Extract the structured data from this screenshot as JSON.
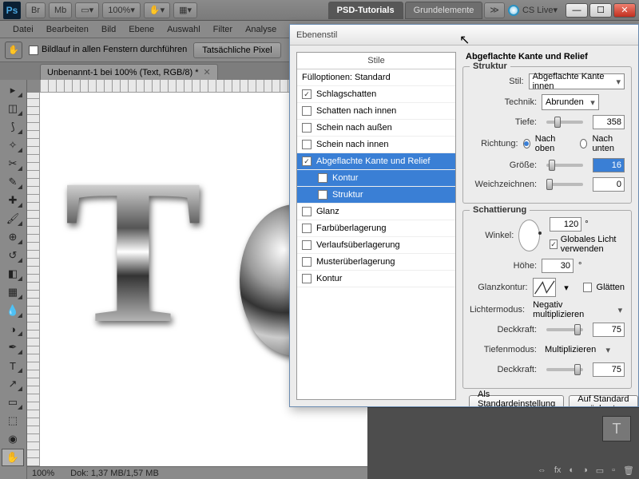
{
  "titlebar": {
    "zoom": "100%",
    "tabs": [
      "PSD-Tutorials",
      "Grundelemente"
    ],
    "cslive": "CS Live"
  },
  "menu": [
    "Datei",
    "Bearbeiten",
    "Bild",
    "Ebene",
    "Auswahl",
    "Filter",
    "Analyse"
  ],
  "optbar": {
    "scroll_all": "Bildlauf in allen Fenstern durchführen",
    "actual_px": "Tatsächliche Pixel"
  },
  "doc": {
    "tab": "Unbenannt-1 bei 100% (Text, RGB/8) *"
  },
  "status": {
    "zoom": "100%",
    "doc": "Dok: 1,37 MB/1,57 MB"
  },
  "dialog": {
    "title": "Ebenenstil",
    "list_head": "Stile",
    "items": [
      {
        "label": "Fülloptionen: Standard",
        "chk": null
      },
      {
        "label": "Schlagschatten",
        "chk": true
      },
      {
        "label": "Schatten nach innen",
        "chk": false
      },
      {
        "label": "Schein nach außen",
        "chk": false
      },
      {
        "label": "Schein nach innen",
        "chk": false
      },
      {
        "label": "Abgeflachte Kante und Relief",
        "chk": true,
        "sel": true
      },
      {
        "label": "Kontur",
        "chk": false,
        "sub": true,
        "sel": true
      },
      {
        "label": "Struktur",
        "chk": false,
        "sub": true,
        "sel": true
      },
      {
        "label": "Glanz",
        "chk": false
      },
      {
        "label": "Farbüberlagerung",
        "chk": false
      },
      {
        "label": "Verlaufsüberlagerung",
        "chk": false
      },
      {
        "label": "Musterüberlagerung",
        "chk": false
      },
      {
        "label": "Kontur",
        "chk": false
      }
    ],
    "section_title": "Abgeflachte Kante und Relief",
    "struktur": {
      "legend": "Struktur",
      "stil_lbl": "Stil:",
      "stil_val": "Abgeflachte Kante innen",
      "technik_lbl": "Technik:",
      "technik_val": "Abrunden",
      "tiefe_lbl": "Tiefe:",
      "tiefe_val": "358",
      "richtung_lbl": "Richtung:",
      "nach_oben": "Nach oben",
      "nach_unten": "Nach unten",
      "groesse_lbl": "Größe:",
      "groesse_val": "16",
      "weich_lbl": "Weichzeichnen:",
      "weich_val": "0"
    },
    "schatt": {
      "legend": "Schattierung",
      "winkel_lbl": "Winkel:",
      "winkel_val": "120",
      "global": "Globales Licht verwenden",
      "hoehe_lbl": "Höhe:",
      "hoehe_val": "30",
      "glanz_lbl": "Glanzkontur:",
      "glaetten": "Glätten",
      "licht_lbl": "Lichtermodus:",
      "licht_val": "Negativ multiplizieren",
      "deck1_lbl": "Deckkraft:",
      "deck1_val": "75",
      "tiefen_lbl": "Tiefenmodus:",
      "tiefen_val": "Multiplizieren",
      "deck2_lbl": "Deckkraft:",
      "deck2_val": "75"
    },
    "btns": {
      "std": "Als Standardeinstellung festlegen",
      "reset": "Auf Standard zurücksetzen"
    }
  }
}
